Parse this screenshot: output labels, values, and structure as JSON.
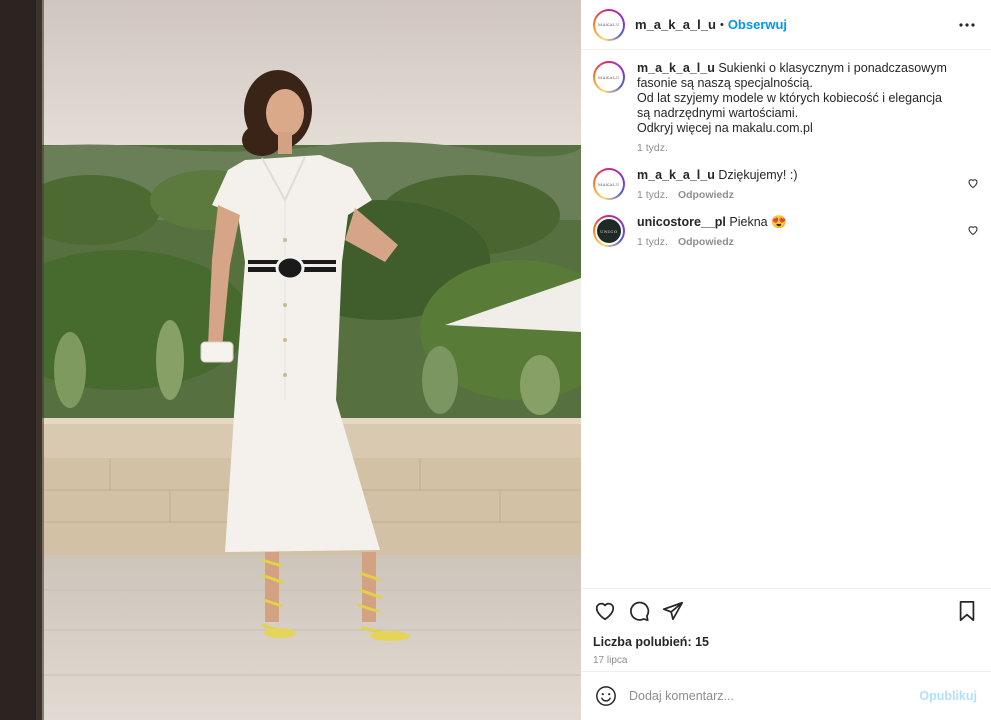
{
  "photo": {
    "alt": "Model in white shirt dress with black-and-white belt and yellow strappy sandals on a terrace"
  },
  "header": {
    "username": "m_a_k_a_l_u",
    "separator": "•",
    "follow_label": "Obserwuj",
    "avatar_text": "MAKALU"
  },
  "caption": {
    "username": "m_a_k_a_l_u",
    "lines": [
      "Sukienki o klasycznym i ponadczasowym fasonie są naszą specjalnością.",
      "Od lat szyjemy modele w których kobiecość i elegancja są nadrzędnymi wartościami.",
      "Odkryj więcej na makalu.com.pl"
    ],
    "time": "1 tydz."
  },
  "comments": [
    {
      "username": "m_a_k_a_l_u",
      "text": "Dziękujemy! :)",
      "time": "1 tydz.",
      "reply": "Odpowiedz",
      "avatar_text": "MAKALU"
    },
    {
      "username": "unicostore__pl",
      "text": "Piekna 😍",
      "time": "1 tydz.",
      "reply": "Odpowiedz",
      "avatar_text": "UNICO"
    }
  ],
  "engagement": {
    "likes": "Liczba polubień: 15",
    "date": "17 lipca"
  },
  "add_comment": {
    "placeholder": "Dodaj komentarz...",
    "publish_label": "Opublikuj"
  },
  "icons": [
    "more-options-icon",
    "heart-icon",
    "comment-icon",
    "share-icon",
    "bookmark-icon",
    "emoji-icon"
  ],
  "colors": {
    "accent": "#0095f6",
    "muted": "#8e8e8e",
    "publish_disabled": "#b2dffc"
  }
}
